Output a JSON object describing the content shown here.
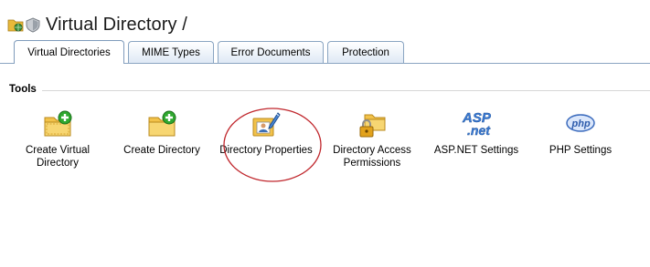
{
  "header": {
    "title": "Virtual Directory /",
    "icons": [
      "folder-globe-icon",
      "shield-icon"
    ]
  },
  "tabs": [
    {
      "label": "Virtual Directories",
      "active": true
    },
    {
      "label": "MIME Types",
      "active": false
    },
    {
      "label": "Error Documents",
      "active": false
    },
    {
      "label": "Protection",
      "active": false
    }
  ],
  "tools_section": {
    "label": "Tools",
    "items": [
      {
        "label": "Create Virtual Directory",
        "icon": "folder-add-icon"
      },
      {
        "label": "Create Directory",
        "icon": "folder-add-icon"
      },
      {
        "label": "Directory Properties",
        "icon": "directory-properties-icon"
      },
      {
        "label": "Directory Access Permissions",
        "icon": "folder-lock-icon"
      },
      {
        "label": "ASP.NET Settings",
        "icon": "aspnet-icon"
      },
      {
        "label": "PHP Settings",
        "icon": "php-icon"
      }
    ]
  },
  "colors": {
    "tab_border": "#8aa5c2",
    "folder": "#f2c24a",
    "plus": "#2fa82f",
    "highlight_oval": "#c0262c"
  }
}
